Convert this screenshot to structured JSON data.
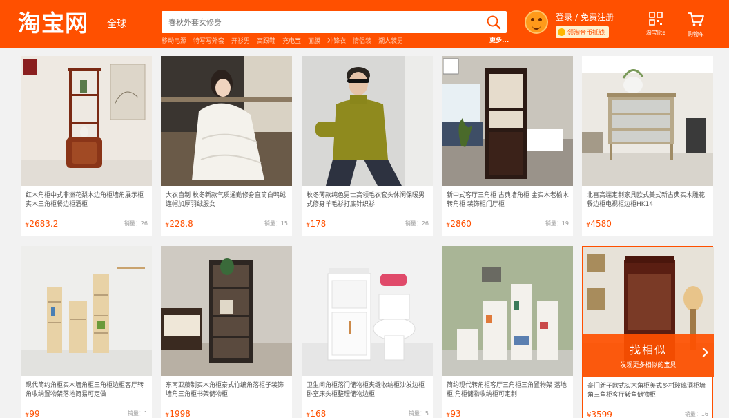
{
  "header": {
    "logo": "淘宝网",
    "logo_sub": "全球",
    "search_placeholder": "春秋外套女修身",
    "hot_words": [
      "移动电源",
      "特写写外套",
      "开衫男",
      "高跟鞋",
      "充电宝",
      "面膜",
      "冲锋衣",
      "情侣装",
      "潮人装男"
    ],
    "more": "更多...",
    "login": "登录",
    "register": "免费注册",
    "coin_label": "领淘金币抵钱",
    "tools": [
      {
        "label": "淘宝lite",
        "icon": "qr-code-icon"
      },
      {
        "label": "购物车",
        "icon": "cart-icon"
      }
    ]
  },
  "accent_color": "#ff5000",
  "products": [
    {
      "title": "红木角柜中式非洲花梨木边角柜墙角展示柜实木三角柜餐边柜酒柜",
      "price": "2683.2",
      "sales": "销量：26"
    },
    {
      "title": "大衣自制 秋冬新款气质通勤修身直筒白鸭绒连帽加厚羽绒服女",
      "price": "228.8",
      "sales": "销量：15"
    },
    {
      "title": "秋冬薄款纯色男士高领毛衣套头休闲保暖男式修身羊毛衫打底针织衫",
      "price": "178",
      "sales": "销量：26"
    },
    {
      "title": "新中式客厅三角柜 古典墙角柜 金实木老榆木转角柜 装饰柜门厅柜",
      "price": "2860",
      "sales": "销量：19"
    },
    {
      "title": "北喜高端定制家具欧式美式新古典实木雕花餐边柜电视柜边柜HK14",
      "price": "4580",
      "sales": ""
    },
    {
      "title": "现代简约角柜实木墙角柜三角柜边柜客厅转角收纳置物架落地简易可定做",
      "price": "99",
      "sales": "销量：1"
    },
    {
      "title": "东南亚藤制实木角柜泰式竹编角落柜子装饰墙角三角柜书架储物柜",
      "price": "1998",
      "sales": ""
    },
    {
      "title": "卫生间角柜落门储物柜夹缝收纳柜沙发边柜卧室床头柜整理储物边柜",
      "price": "168",
      "sales": "销量：5"
    },
    {
      "title": "简约现代转角柜客厅三角柜三角置物架 落地柜,角柜储物收纳柜可定制",
      "price": "93",
      "sales": ""
    },
    {
      "title": "豪门新子欧式实木角柜美式乡村玻璃酒柜墙角三角柜客厅转角储物柜",
      "price": "3599",
      "sales": "销量：16"
    }
  ],
  "find_similar": {
    "title": "找相似",
    "subtitle": "发现更多相似的宝贝"
  },
  "currency": "¥"
}
